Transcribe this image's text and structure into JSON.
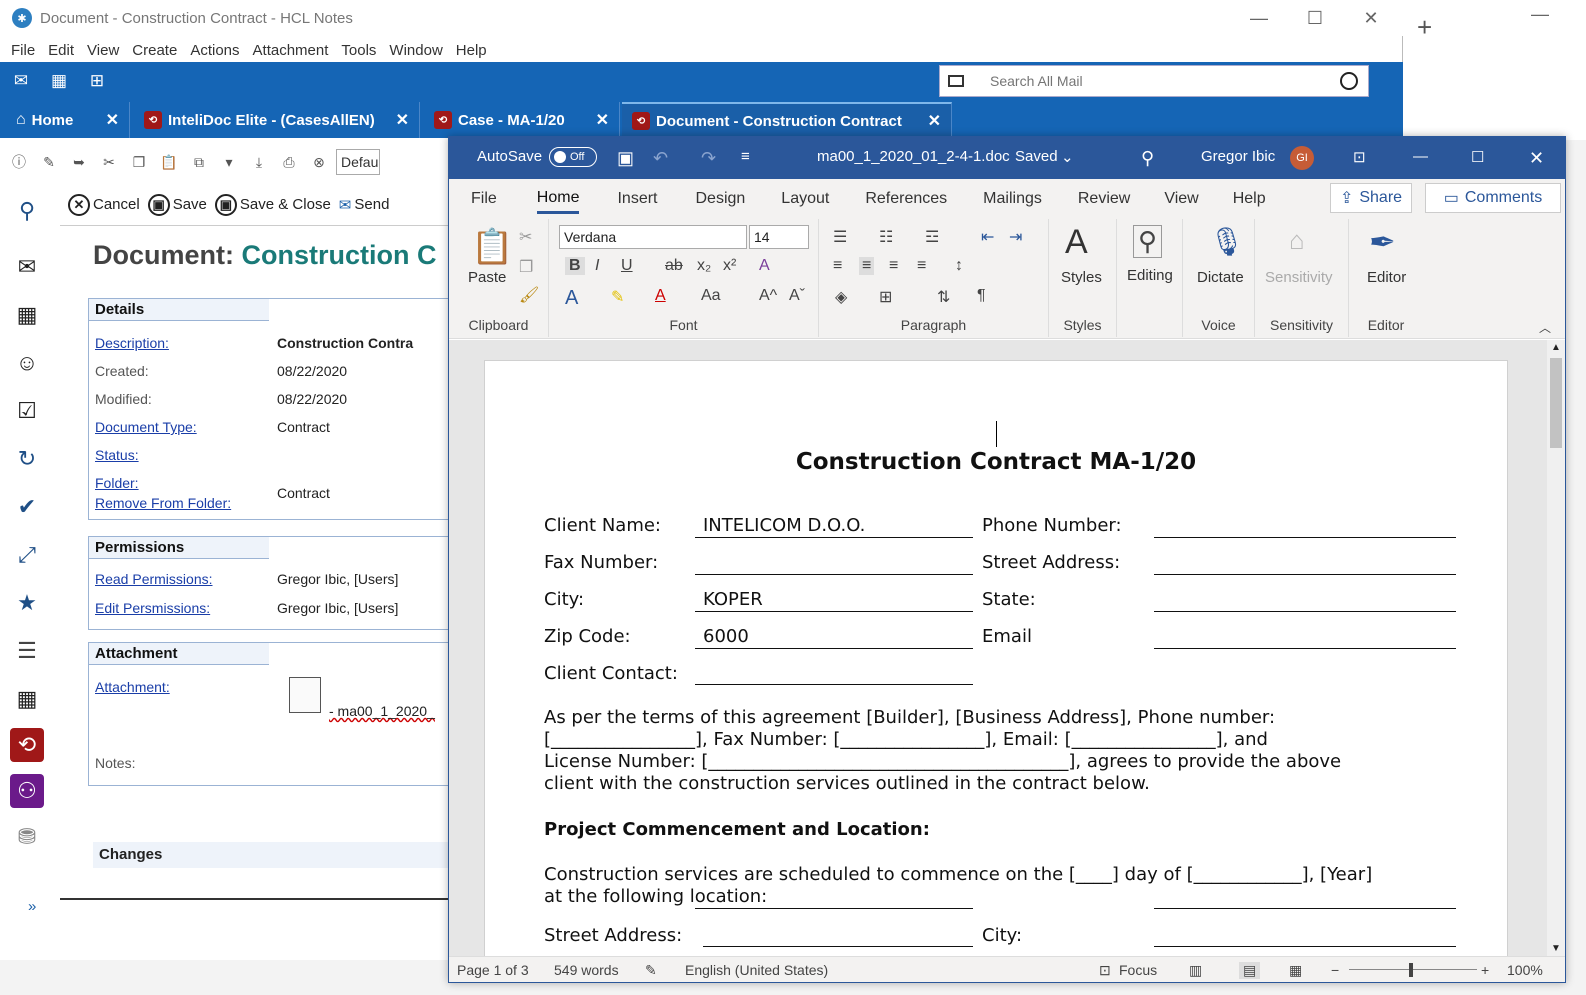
{
  "notes": {
    "window_title": "Document - Construction Contract - HCL Notes",
    "menu": [
      "File",
      "Edit",
      "View",
      "Create",
      "Actions",
      "Attachment",
      "Tools",
      "Window",
      "Help"
    ],
    "search_placeholder": "Search All Mail",
    "tabs": [
      {
        "label": "Home"
      },
      {
        "label": "InteliDoc Elite - (CasesAllEN)"
      },
      {
        "label": "Case - MA-1/20"
      },
      {
        "label": "Document - Construction Contract"
      }
    ],
    "toolbar_default": "Defau",
    "actions": {
      "cancel": "Cancel",
      "save": "Save",
      "save_close": "Save & Close",
      "send": "Send"
    },
    "heading_prefix": "Document: ",
    "heading_name": "Construction C",
    "details": {
      "header": "Details",
      "description_label": "Description:",
      "description_value": "Construction Contra",
      "created_label": "Created:",
      "created_value": "08/22/2020",
      "modified_label": "Modified:",
      "modified_value": "08/22/2020",
      "doctype_label": "Document Type:",
      "doctype_value": "Contract",
      "status_label": "Status:",
      "folder_label": "Folder:",
      "remove_folder_label": "Remove From Folder:",
      "folder_value": "Contract"
    },
    "permissions": {
      "header": "Permissions",
      "read_label": "Read Permissions:",
      "read_value": "Gregor Ibic, [Users]",
      "edit_label": "Edit Persmissions:",
      "edit_value": "Gregor Ibic, [Users]"
    },
    "attachment": {
      "header": "Attachment",
      "attachment_label": "Attachment:",
      "file_name": "- ma00_1_2020_",
      "notes_label": "Notes:"
    },
    "changes_header": "Changes",
    "expander": "»"
  },
  "word": {
    "autosave_label": "AutoSave",
    "autosave_state": "Off",
    "file_name": "ma00_1_2020_01_2-4-1.doc",
    "saved_state": "Saved",
    "user_name": "Gregor Ibic",
    "user_initials": "GI",
    "tabs": [
      "File",
      "Home",
      "Insert",
      "Design",
      "Layout",
      "References",
      "Mailings",
      "Review",
      "View",
      "Help"
    ],
    "share_label": "Share",
    "comments_label": "Comments",
    "ribbon": {
      "paste": "Paste",
      "clipboard": "Clipboard",
      "font_name": "Verdana",
      "font_size": "14",
      "font": "Font",
      "paragraph": "Paragraph",
      "styles_btn": "Styles",
      "styles": "Styles",
      "editing": "Editing",
      "dictate": "Dictate",
      "voice": "Voice",
      "sensitivity_btn": "Sensitivity",
      "sensitivity": "Sensitivity",
      "editor_btn": "Editor",
      "editor": "Editor"
    },
    "doc": {
      "title": "Construction Contract MA-1/20",
      "client_name_label": "Client Name:",
      "client_name_value": "INTELICOM D.O.O.",
      "phone_label": "Phone Number:",
      "fax_label": "Fax Number:",
      "street_label": "Street Address:",
      "city_label": "City:",
      "city_value": "KOPER",
      "state_label": "State:",
      "zip_label": "Zip Code:",
      "zip_value": "6000",
      "email_label": "Email",
      "contact_label": "Client Contact:",
      "para1_l1": "As per the terms of this agreement [Builder], [Business Address], Phone number:",
      "para1_l2": "[________________], Fax Number: [________________], Email: [________________], and",
      "para1_l3": "License Number: [________________________________________], agrees to provide the above",
      "para1_l4": "client with the construction services outlined in the contract below.",
      "section_heading": "Project Commencement and Location:",
      "para2_l1": "Construction services are scheduled to commence on the [____] day of [____________], [Year]",
      "para2_l2": "at the following location:",
      "street2_label": "Street Address:",
      "city2_label": "City:"
    },
    "status": {
      "page": "Page 1 of 3",
      "words": "549 words",
      "language": "English (United States)",
      "focus": "Focus",
      "zoom": "100%"
    }
  }
}
